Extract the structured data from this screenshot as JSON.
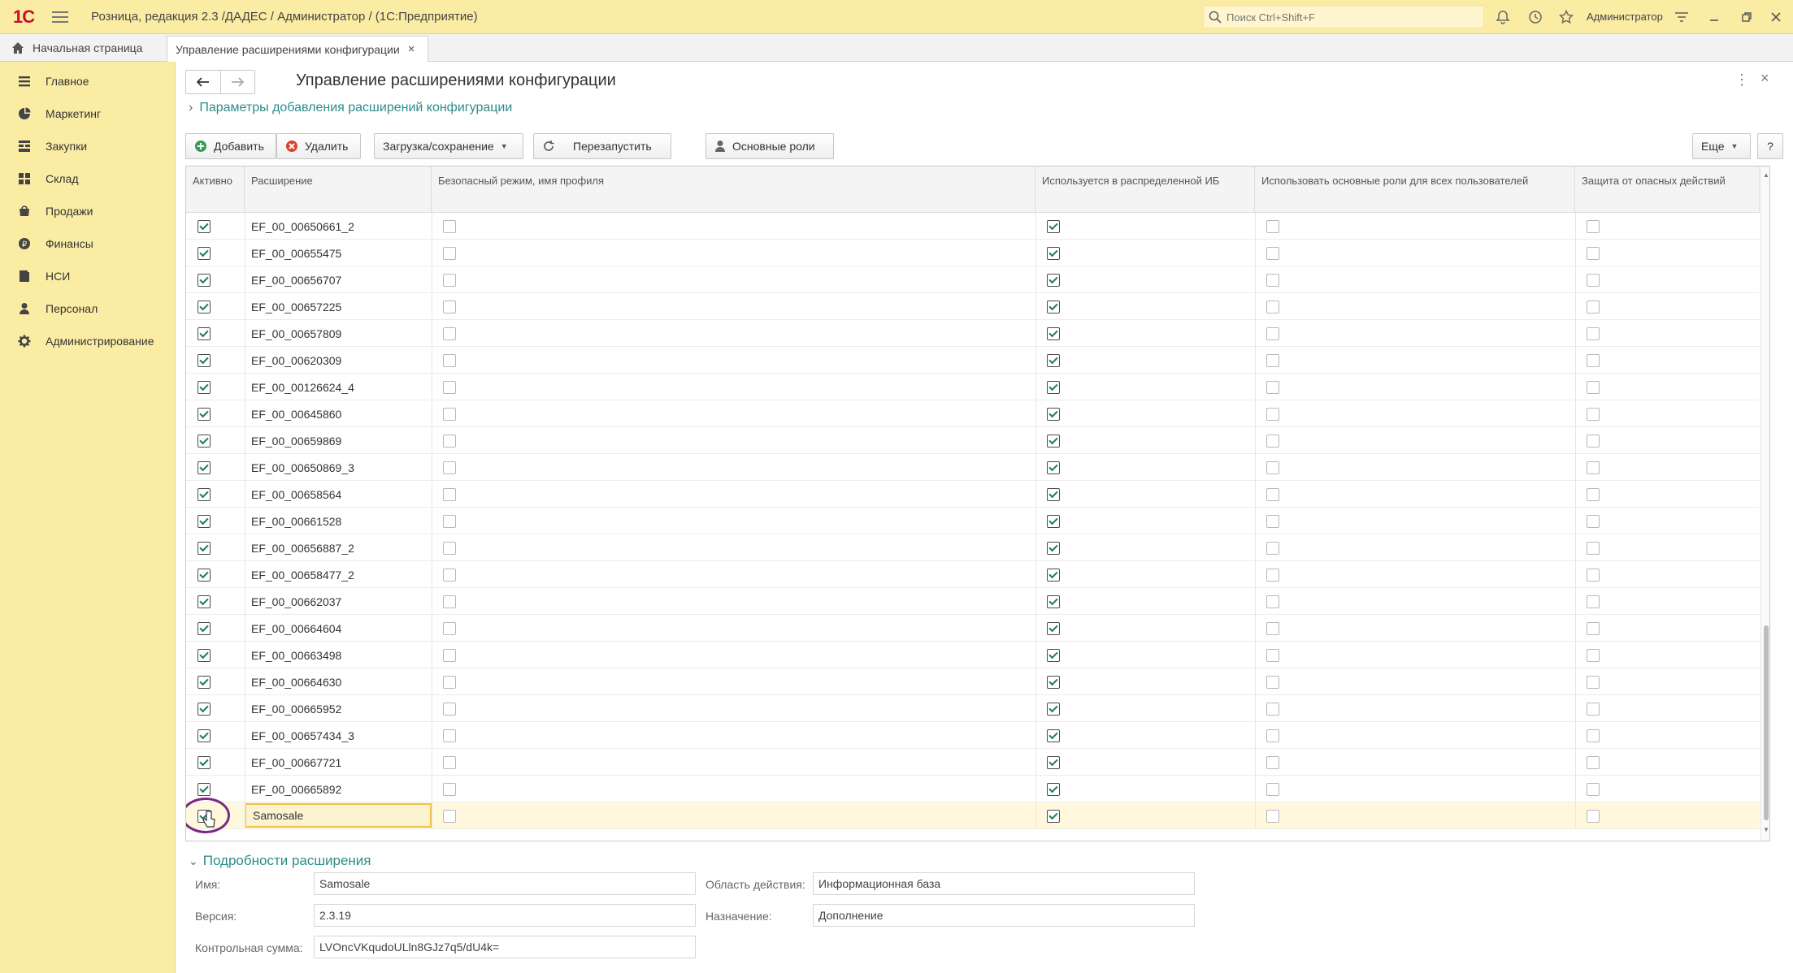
{
  "titlebar": {
    "logo": "1С",
    "title": "Розница, редакция 2.3 /ДАДЕС / Администратор /  (1С:Предприятие)",
    "search_placeholder": "Поиск Ctrl+Shift+F",
    "user": "Администратор"
  },
  "tabs": {
    "home": "Начальная страница",
    "active": "Управление расширениями конфигурации"
  },
  "sidebar": {
    "items": [
      {
        "label": "Главное",
        "icon": "menu-lines-icon"
      },
      {
        "label": "Маркетинг",
        "icon": "pie-chart-icon"
      },
      {
        "label": "Закупки",
        "icon": "purchase-icon"
      },
      {
        "label": "Склад",
        "icon": "warehouse-grid-icon"
      },
      {
        "label": "Продажи",
        "icon": "cart-icon"
      },
      {
        "label": "Финансы",
        "icon": "coin-icon"
      },
      {
        "label": "НСИ",
        "icon": "book-icon"
      },
      {
        "label": "Персонал",
        "icon": "person-icon"
      },
      {
        "label": "Администрирование",
        "icon": "gear-icon"
      }
    ]
  },
  "form": {
    "title": "Управление расширениями конфигурации",
    "params_link": "Параметры добавления расширений конфигурации",
    "more_glyph": "⋮",
    "close_glyph": "×"
  },
  "toolbar": {
    "add": "Добавить",
    "delete": "Удалить",
    "load_save": "Загрузка/сохранение",
    "restart": "Перезапустить",
    "roles": "Основные роли",
    "more": "Еще",
    "help": "?"
  },
  "grid": {
    "columns": {
      "active": "Активно",
      "extension": "Расширение",
      "safe_mode": "Безопасный режим, имя профиля",
      "distributed": "Используется в распределенной ИБ",
      "main_roles": "Использовать основные роли для всех пользователей",
      "protection": "Защита от опасных действий"
    },
    "rows": [
      {
        "active": true,
        "name": "EF_00_00650661_2",
        "safe": false,
        "distributed": true,
        "roles": false,
        "protect": false
      },
      {
        "active": true,
        "name": "EF_00_00655475",
        "safe": false,
        "distributed": true,
        "roles": false,
        "protect": false
      },
      {
        "active": true,
        "name": "EF_00_00656707",
        "safe": false,
        "distributed": true,
        "roles": false,
        "protect": false
      },
      {
        "active": true,
        "name": "EF_00_00657225",
        "safe": false,
        "distributed": true,
        "roles": false,
        "protect": false
      },
      {
        "active": true,
        "name": "EF_00_00657809",
        "safe": false,
        "distributed": true,
        "roles": false,
        "protect": false
      },
      {
        "active": true,
        "name": "EF_00_00620309",
        "safe": false,
        "distributed": true,
        "roles": false,
        "protect": false
      },
      {
        "active": true,
        "name": "EF_00_00126624_4",
        "safe": false,
        "distributed": true,
        "roles": false,
        "protect": false
      },
      {
        "active": true,
        "name": "EF_00_00645860",
        "safe": false,
        "distributed": true,
        "roles": false,
        "protect": false
      },
      {
        "active": true,
        "name": "EF_00_00659869",
        "safe": false,
        "distributed": true,
        "roles": false,
        "protect": false
      },
      {
        "active": true,
        "name": "EF_00_00650869_3",
        "safe": false,
        "distributed": true,
        "roles": false,
        "protect": false
      },
      {
        "active": true,
        "name": "EF_00_00658564",
        "safe": false,
        "distributed": true,
        "roles": false,
        "protect": false
      },
      {
        "active": true,
        "name": "EF_00_00661528",
        "safe": false,
        "distributed": true,
        "roles": false,
        "protect": false
      },
      {
        "active": true,
        "name": "EF_00_00656887_2",
        "safe": false,
        "distributed": true,
        "roles": false,
        "protect": false
      },
      {
        "active": true,
        "name": "EF_00_00658477_2",
        "safe": false,
        "distributed": true,
        "roles": false,
        "protect": false
      },
      {
        "active": true,
        "name": "EF_00_00662037",
        "safe": false,
        "distributed": true,
        "roles": false,
        "protect": false
      },
      {
        "active": true,
        "name": "EF_00_00664604",
        "safe": false,
        "distributed": true,
        "roles": false,
        "protect": false
      },
      {
        "active": true,
        "name": "EF_00_00663498",
        "safe": false,
        "distributed": true,
        "roles": false,
        "protect": false
      },
      {
        "active": true,
        "name": "EF_00_00664630",
        "safe": false,
        "distributed": true,
        "roles": false,
        "protect": false
      },
      {
        "active": true,
        "name": "EF_00_00665952",
        "safe": false,
        "distributed": true,
        "roles": false,
        "protect": false
      },
      {
        "active": true,
        "name": "EF_00_00657434_3",
        "safe": false,
        "distributed": true,
        "roles": false,
        "protect": false
      },
      {
        "active": true,
        "name": "EF_00_00667721",
        "safe": false,
        "distributed": true,
        "roles": false,
        "protect": false
      },
      {
        "active": true,
        "name": "EF_00_00665892",
        "safe": false,
        "distributed": true,
        "roles": false,
        "protect": false
      },
      {
        "active": true,
        "name": "Samosale",
        "safe": false,
        "distributed": true,
        "roles": false,
        "protect": false,
        "selected": true
      }
    ]
  },
  "details": {
    "title": "Подробности расширения",
    "name_label": "Имя:",
    "name_value": "Samosale",
    "version_label": "Версия:",
    "version_value": "2.3.19",
    "checksum_label": "Контрольная сумма:",
    "checksum_value": "LVOncVKqudoULln8GJz7q5/dU4k=",
    "scope_label": "Область действия:",
    "scope_value": "Информационная база",
    "purpose_label": "Назначение:",
    "purpose_value": "Дополнение"
  },
  "colors": {
    "titlebar_bg": "#fbeca4",
    "accent_link": "#2e8b8b",
    "selection": "#fff8dd",
    "annotation_circle": "#7a2a82"
  }
}
